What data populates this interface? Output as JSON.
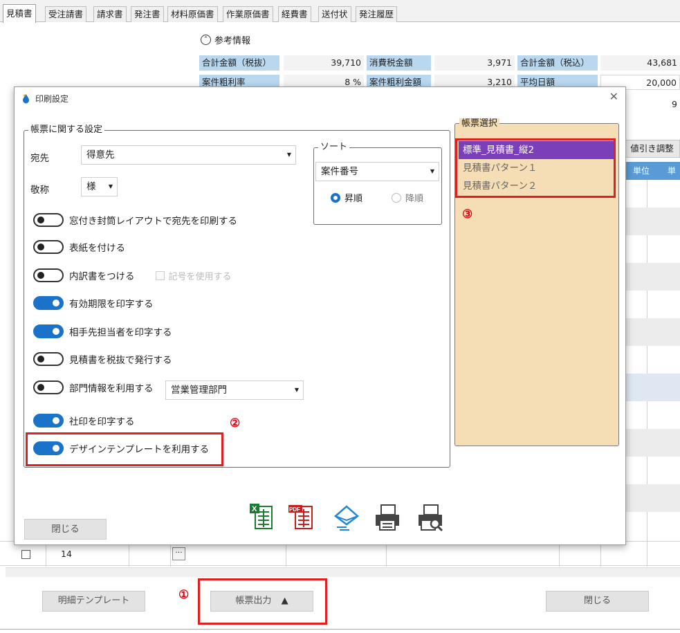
{
  "tabs": [
    "見積書",
    "受注請書",
    "請求書",
    "発注書",
    "材料原価書",
    "作業原価書",
    "経費書",
    "送付状",
    "発注履歴"
  ],
  "reference": {
    "header": "参考情報",
    "total_ex_tax_label": "合計金額（税抜）",
    "total_ex_tax_value": "39,710",
    "tax_label": "消費税金額",
    "tax_value": "3,971",
    "total_in_tax_label": "合計金額（税込）",
    "total_in_tax_value": "43,681",
    "profit_rate_label": "案件粗利率",
    "profit_rate_value": "8 %",
    "profit_amount_label": "案件粗利金額",
    "profit_amount_value": "3,210",
    "unit_avg_label": "平均日額",
    "unit_avg_value": "20,000",
    "partial_value": "9"
  },
  "background": {
    "discount_button": "値引き調整",
    "grid_header_unit": "単位",
    "grid_header_price": "単",
    "row_number": "14",
    "row_dots": "···"
  },
  "dialog": {
    "title": "印刷設定",
    "settings_group": "帳票に関する設定",
    "recipient_label": "宛先",
    "recipient_value": "得意先",
    "honorific_label": "敬称",
    "honorific_value": "様",
    "sort_group": "ソート",
    "sort_value": "案件番号",
    "sort_asc": "昇順",
    "sort_desc": "降順",
    "toggles": [
      {
        "label": "窓付き封筒レイアウトで宛先を印刷する",
        "on": false
      },
      {
        "label": "表紙を付ける",
        "on": false
      },
      {
        "label": "内訳書をつける",
        "on": false
      },
      {
        "label": "有効期限を印字する",
        "on": true
      },
      {
        "label": "相手先担当者を印字する",
        "on": true
      },
      {
        "label": "見積書を税抜で発行する",
        "on": false
      },
      {
        "label": "部門情報を利用する",
        "on": false
      },
      {
        "label": "社印を印字する",
        "on": true
      },
      {
        "label": "デザインテンプレートを利用する",
        "on": true
      }
    ],
    "use_symbol_label": "記号を使用する",
    "department_value": "営業管理部門",
    "slip_group": "帳票選択",
    "slip_items": [
      "標準_見積書_縦2",
      "見積書パターン１",
      "見積書パターン２"
    ],
    "close_button": "閉じる",
    "icons": [
      "excel-icon",
      "pdf-icon",
      "mail-icon",
      "print-icon",
      "print-preview-icon"
    ]
  },
  "bottom": {
    "detail_template_button": "明細テンプレート",
    "slip_output_button": "帳票出力",
    "close_button": "閉じる"
  },
  "markers": {
    "m1": "①",
    "m2": "②",
    "m3": "③"
  },
  "colors": {
    "accent_blue": "#1a73c9",
    "selection_purple": "#7b3fb9",
    "highlight_red": "#e02020",
    "slip_panel_bg": "#f5deb6",
    "ref_label_bg": "#b9d7ee"
  }
}
